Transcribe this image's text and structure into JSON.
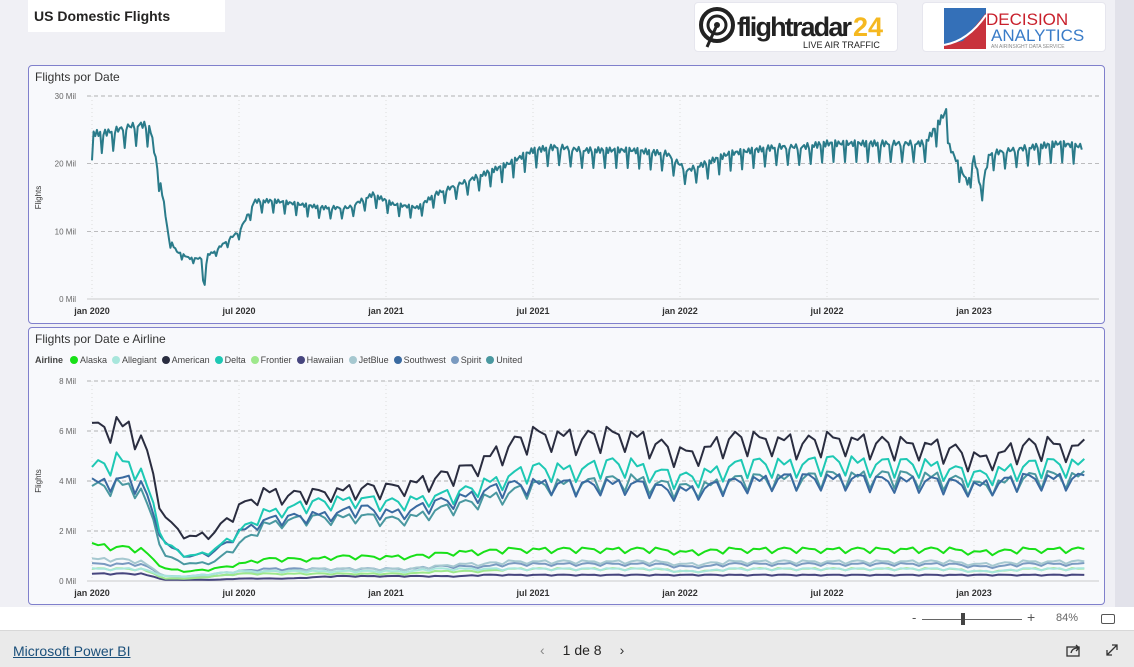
{
  "header": {
    "title": "US Domestic Flights",
    "logo1": {
      "text": "flightradar24",
      "sub": "LIVE AIR TRAFFIC"
    },
    "logo2": {
      "line1": "DECISION",
      "line2": "ANALYTICS",
      "sub": "AN AIRINSIGHT DATA SERVICE"
    }
  },
  "chart_data": [
    {
      "type": "line",
      "title": "Flights por Date",
      "xlabel": "",
      "ylabel": "Flights",
      "ylim": [
        0,
        30
      ],
      "yticks": [
        "0 Mil",
        "10 Mil",
        "20 Mil",
        "30 Mil"
      ],
      "ytick_values": [
        0,
        10,
        20,
        30
      ],
      "xticks": [
        "jan 2020",
        "jul 2020",
        "jan 2021",
        "jul 2021",
        "jan 2022",
        "jul 2022",
        "jan 2023"
      ],
      "xtick_dates": [
        "2020-01-01",
        "2020-07-01",
        "2021-01-01",
        "2021-07-01",
        "2022-01-01",
        "2022-07-01",
        "2023-01-01"
      ],
      "grid": true,
      "color": "#2a7b8a",
      "points": [
        [
          "2020-01-01",
          20.5
        ],
        [
          "2020-01-03",
          24.5
        ],
        [
          "2020-01-15",
          24.5
        ],
        [
          "2020-02-01",
          25
        ],
        [
          "2020-02-15",
          25.5
        ],
        [
          "2020-03-01",
          25.8
        ],
        [
          "2020-03-12",
          25.5
        ],
        [
          "2020-03-20",
          20
        ],
        [
          "2020-03-28",
          15
        ],
        [
          "2020-04-05",
          9
        ],
        [
          "2020-04-15",
          7
        ],
        [
          "2020-05-01",
          6
        ],
        [
          "2020-05-15",
          6
        ],
        [
          "2020-05-18",
          1
        ],
        [
          "2020-05-22",
          6.5
        ],
        [
          "2020-06-01",
          7
        ],
        [
          "2020-06-15",
          8.5
        ],
        [
          "2020-07-01",
          10
        ],
        [
          "2020-07-10",
          12
        ],
        [
          "2020-07-20",
          14.5
        ],
        [
          "2020-08-15",
          14.5
        ],
        [
          "2020-09-15",
          14
        ],
        [
          "2020-10-15",
          13.5
        ],
        [
          "2020-11-15",
          13.5
        ],
        [
          "2020-12-15",
          15.5
        ],
        [
          "2021-01-10",
          14
        ],
        [
          "2021-02-10",
          13.5
        ],
        [
          "2021-03-01",
          15.5
        ],
        [
          "2021-04-01",
          17
        ],
        [
          "2021-05-01",
          18.5
        ],
        [
          "2021-06-01",
          20
        ],
        [
          "2021-07-01",
          22
        ],
        [
          "2021-08-01",
          22.5
        ],
        [
          "2021-09-01",
          22
        ],
        [
          "2021-10-01",
          22
        ],
        [
          "2021-11-01",
          22
        ],
        [
          "2021-12-15",
          21.5
        ],
        [
          "2022-01-10",
          19
        ],
        [
          "2022-02-01",
          20
        ],
        [
          "2022-03-01",
          21.5
        ],
        [
          "2022-04-01",
          22
        ],
        [
          "2022-05-01",
          22.5
        ],
        [
          "2022-06-01",
          22.5
        ],
        [
          "2022-07-01",
          23
        ],
        [
          "2022-08-01",
          23
        ],
        [
          "2022-09-01",
          23
        ],
        [
          "2022-10-01",
          23
        ],
        [
          "2022-11-01",
          23
        ],
        [
          "2022-11-28",
          28
        ],
        [
          "2022-12-01",
          22.5
        ],
        [
          "2022-12-24",
          17
        ],
        [
          "2023-01-01",
          21
        ],
        [
          "2023-01-10",
          16
        ],
        [
          "2023-01-20",
          21.5
        ],
        [
          "2023-02-15",
          22
        ],
        [
          "2023-03-15",
          22.5
        ],
        [
          "2023-04-15",
          23
        ],
        [
          "2023-05-15",
          22.5
        ]
      ]
    },
    {
      "type": "line",
      "title": "Flights por Date e Airline",
      "xlabel": "",
      "ylabel": "Flights",
      "ylim": [
        0,
        8
      ],
      "legend_title": "Airline",
      "legend": "top-left",
      "yticks": [
        "0 Mil",
        "2 Mil",
        "4 Mil",
        "6 Mil",
        "8 Mil"
      ],
      "ytick_values": [
        0,
        2,
        4,
        6,
        8
      ],
      "xticks": [
        "jan 2020",
        "jul 2020",
        "jan 2021",
        "jul 2021",
        "jan 2022",
        "jul 2022",
        "jan 2023"
      ],
      "xtick_dates": [
        "2020-01-01",
        "2020-07-01",
        "2021-01-01",
        "2021-07-01",
        "2022-01-01",
        "2022-07-01",
        "2023-01-01"
      ],
      "grid": true,
      "start_month": "2020-01",
      "series": [
        {
          "name": "Alaska",
          "color": "#18e018",
          "values": [
            1.5,
            1.4,
            1.3,
            0.5,
            0.4,
            0.5,
            0.7,
            0.9,
            0.9,
            0.9,
            1,
            1,
            1,
            1,
            1.1,
            1.2,
            1.2,
            1.3,
            1.3,
            1.3,
            1.3,
            1.3,
            1.3,
            1.3,
            1.2,
            1.2,
            1.3,
            1.3,
            1.3,
            1.3,
            1.3,
            1.3,
            1.3,
            1.3,
            1.3,
            1.3,
            1.2,
            1.2,
            1.3,
            1.3,
            1.3
          ]
        },
        {
          "name": "Allegiant",
          "color": "#a8e6dc",
          "values": [
            0.5,
            0.5,
            0.5,
            0.2,
            0.2,
            0.3,
            0.4,
            0.4,
            0.4,
            0.4,
            0.4,
            0.4,
            0.4,
            0.4,
            0.5,
            0.5,
            0.5,
            0.5,
            0.5,
            0.5,
            0.5,
            0.5,
            0.5,
            0.5,
            0.4,
            0.4,
            0.5,
            0.5,
            0.5,
            0.5,
            0.5,
            0.5,
            0.5,
            0.5,
            0.5,
            0.5,
            0.4,
            0.4,
            0.5,
            0.5,
            0.5
          ]
        },
        {
          "name": "American",
          "color": "#2a2d40",
          "values": [
            6.2,
            6.5,
            6,
            2.5,
            1.8,
            2,
            3,
            3.7,
            3.5,
            3.6,
            3.7,
            3.8,
            3.8,
            4,
            4.2,
            4.5,
            5,
            5.5,
            6,
            6,
            5.8,
            6,
            6,
            5.6,
            5.2,
            5.4,
            5.8,
            5.8,
            5.8,
            5.6,
            5.8,
            5.8,
            5.6,
            5.6,
            5.6,
            5.4,
            5,
            5.2,
            5.5,
            5.6,
            5.5
          ]
        },
        {
          "name": "Delta",
          "color": "#1ec8b4",
          "values": [
            4.6,
            5,
            4.6,
            1.5,
            1,
            1.3,
            2,
            2.8,
            3,
            3.2,
            3.3,
            3.4,
            3.2,
            3.3,
            3.5,
            3.6,
            4,
            4.3,
            4.6,
            4.6,
            4.6,
            4.8,
            4.8,
            4.5,
            4.2,
            4.4,
            4.7,
            4.8,
            4.8,
            4.8,
            4.9,
            4.9,
            4.8,
            4.8,
            4.8,
            4.6,
            4.3,
            4.5,
            4.7,
            4.8,
            4.8
          ]
        },
        {
          "name": "Frontier",
          "color": "#9ee88c",
          "values": [
            0.5,
            0.5,
            0.5,
            0.1,
            0.1,
            0.2,
            0.3,
            0.3,
            0.3,
            0.3,
            0.3,
            0.3,
            0.3,
            0.3,
            0.4,
            0.4,
            0.4,
            0.5,
            0.5,
            0.5,
            0.5,
            0.5,
            0.5,
            0.5,
            0.4,
            0.4,
            0.5,
            0.5,
            0.5,
            0.5,
            0.5,
            0.5,
            0.5,
            0.5,
            0.5,
            0.5,
            0.4,
            0.4,
            0.5,
            0.5,
            0.5
          ]
        },
        {
          "name": "Hawaiian",
          "color": "#46457e",
          "values": [
            0.3,
            0.3,
            0.3,
            0.05,
            0.05,
            0.05,
            0.1,
            0.1,
            0.1,
            0.15,
            0.2,
            0.2,
            0.2,
            0.2,
            0.2,
            0.2,
            0.25,
            0.25,
            0.25,
            0.25,
            0.25,
            0.25,
            0.25,
            0.25,
            0.25,
            0.25,
            0.25,
            0.25,
            0.25,
            0.25,
            0.25,
            0.25,
            0.25,
            0.25,
            0.25,
            0.25,
            0.25,
            0.25,
            0.25,
            0.25,
            0.25
          ]
        },
        {
          "name": "JetBlue",
          "color": "#a6c8d0",
          "values": [
            0.9,
            0.9,
            0.8,
            0.2,
            0.15,
            0.2,
            0.3,
            0.4,
            0.4,
            0.5,
            0.5,
            0.5,
            0.5,
            0.5,
            0.6,
            0.7,
            0.7,
            0.8,
            0.8,
            0.8,
            0.8,
            0.8,
            0.8,
            0.8,
            0.7,
            0.7,
            0.8,
            0.8,
            0.8,
            0.8,
            0.8,
            0.8,
            0.8,
            0.8,
            0.8,
            0.8,
            0.7,
            0.7,
            0.8,
            0.8,
            0.8
          ]
        },
        {
          "name": "Southwest",
          "color": "#3a6aa0",
          "values": [
            4,
            4.2,
            4,
            1.5,
            1,
            1.2,
            2,
            2.5,
            2.6,
            2.7,
            2.8,
            3,
            2.8,
            2.9,
            3.2,
            3.4,
            3.7,
            3.9,
            4,
            4,
            3.9,
            4,
            4,
            3.8,
            3.7,
            3.8,
            4,
            4.1,
            4.2,
            4.2,
            4.2,
            4.2,
            4.1,
            4.1,
            4.1,
            4,
            3.9,
            4,
            4.2,
            4.2,
            4.2
          ]
        },
        {
          "name": "Spirit",
          "color": "#7a9ac0",
          "values": [
            0.7,
            0.7,
            0.7,
            0.2,
            0.2,
            0.3,
            0.4,
            0.5,
            0.5,
            0.5,
            0.5,
            0.5,
            0.5,
            0.5,
            0.6,
            0.6,
            0.6,
            0.7,
            0.7,
            0.7,
            0.7,
            0.7,
            0.7,
            0.7,
            0.6,
            0.6,
            0.7,
            0.7,
            0.7,
            0.7,
            0.7,
            0.7,
            0.7,
            0.7,
            0.7,
            0.7,
            0.6,
            0.6,
            0.7,
            0.7,
            0.7
          ]
        },
        {
          "name": "United",
          "color": "#4a98a0",
          "values": [
            3.8,
            4,
            3.8,
            1,
            0.7,
            0.8,
            1.5,
            2.3,
            2.5,
            2.6,
            2.6,
            2.7,
            2.5,
            2.6,
            2.9,
            3.1,
            3.4,
            3.6,
            3.9,
            4,
            4,
            4.1,
            4.2,
            4,
            3.8,
            3.9,
            4.1,
            4.2,
            4.2,
            4.2,
            4.3,
            4.3,
            4.3,
            4.3,
            4.3,
            4.2,
            3.9,
            4,
            4.2,
            4.3,
            4.3
          ]
        }
      ]
    }
  ],
  "zoom": {
    "minus": "-",
    "plus": "+",
    "level": "84%",
    "level_fraction": 0.84
  },
  "footer": {
    "brand": "Microsoft Power BI",
    "page": "1 de 8",
    "prev": "‹",
    "next": "›"
  },
  "icons": {
    "fit": "fit-to-page-icon",
    "share": "share-icon",
    "fullscreen": "expand-icon"
  }
}
